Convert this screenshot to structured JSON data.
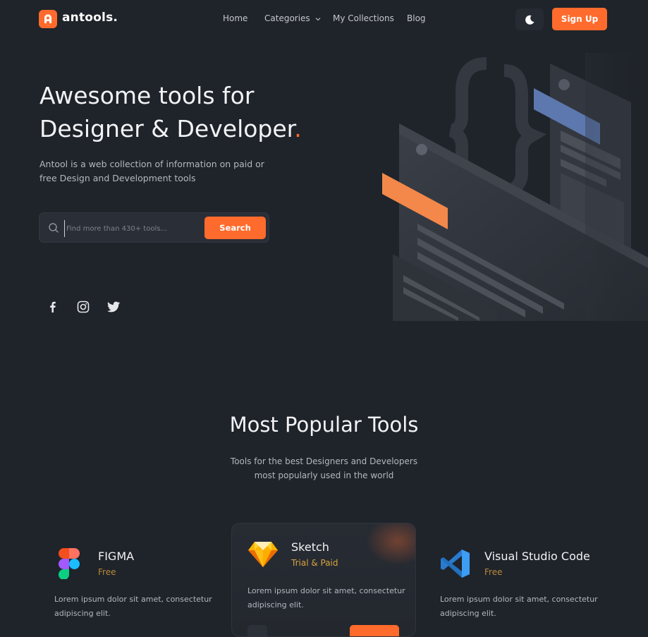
{
  "brand": {
    "name": "antools.",
    "accent": "#ff6b2c"
  },
  "nav": {
    "items": [
      {
        "label": "Home"
      },
      {
        "label": "Categories"
      },
      {
        "label": "My Collections"
      },
      {
        "label": "Blog"
      }
    ],
    "theme_icon": "moon-icon",
    "signup_label": "Sign Up"
  },
  "hero": {
    "title_line1": "Awesome tools for",
    "title_line2": "Designer & Developer",
    "title_dot": ".",
    "description": "Antool is a web collection of information on paid or free Design and Development tools",
    "search_placeholder": "Find more than 430+ tools...",
    "search_button": "Search",
    "social": [
      "facebook-icon",
      "instagram-icon",
      "twitter-icon"
    ]
  },
  "popular": {
    "title": "Most Popular Tools",
    "subtitle_line1": "Tools for the best Designers and Developers",
    "subtitle_line2": "most popularly used in the world",
    "tools": [
      {
        "name": "FIGMA",
        "type": "Free",
        "description": "Lorem ipsum dolor sit amet, consectetur adipiscing elit."
      },
      {
        "name": "Sketch",
        "type": "Trial & Paid",
        "description": "Lorem ipsum dolor sit amet, consectetur adipiscing elit."
      },
      {
        "name": "Visual Studio Code",
        "type": "Free",
        "description": "Lorem ipsum dolor sit amet, consectetur adipiscing elit."
      }
    ]
  }
}
